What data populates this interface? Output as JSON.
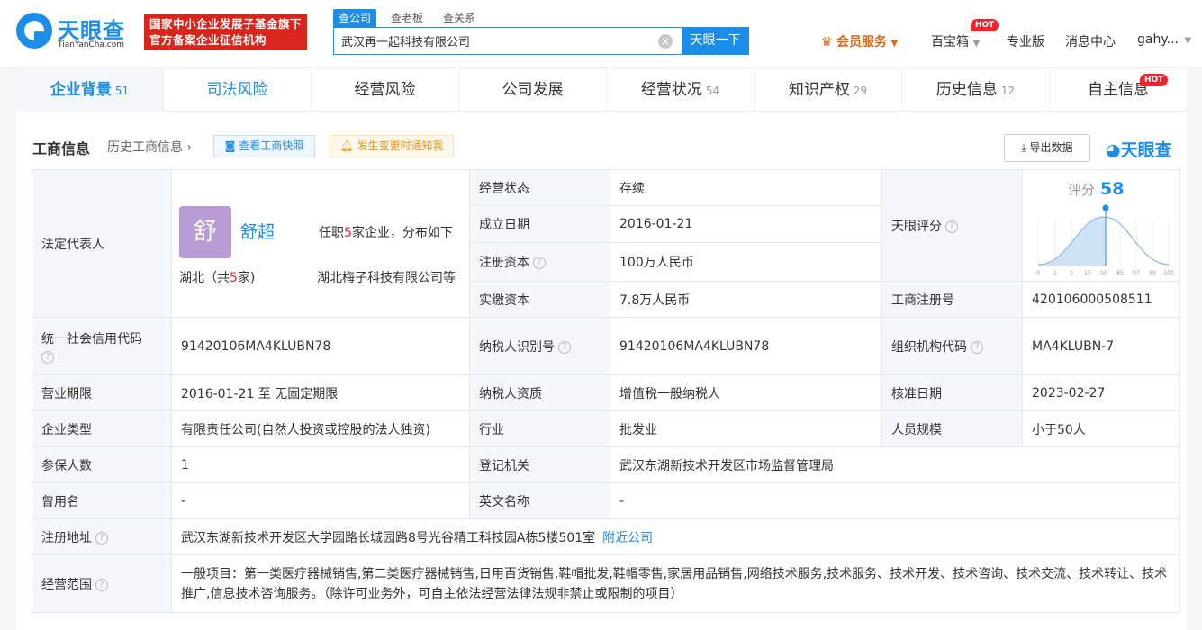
{
  "brand": {
    "name": "天眼查",
    "domain": "TianYanCha.com",
    "badge_line1": "国家中小企业发展子基金旗下",
    "badge_line2": "官方备案企业征信机构"
  },
  "search": {
    "tabs": [
      "查公司",
      "查老板",
      "查关系"
    ],
    "value": "武汉再一起科技有限公司",
    "button": "天眼一下",
    "clear": "×"
  },
  "nav": {
    "vip": "会员服务",
    "baibao": "百宝箱",
    "hot": "HOT",
    "pro": "专业版",
    "msg": "消息中心",
    "user": "gahy..."
  },
  "tabs": [
    {
      "label": "企业背景",
      "count": "51"
    },
    {
      "label": "司法风险",
      "count": ""
    },
    {
      "label": "经营风险",
      "count": ""
    },
    {
      "label": "公司发展",
      "count": ""
    },
    {
      "label": "经营状况",
      "count": "54"
    },
    {
      "label": "知识产权",
      "count": "29"
    },
    {
      "label": "历史信息",
      "count": "12"
    },
    {
      "label": "自主信息",
      "count": ""
    }
  ],
  "section": {
    "title": "工商信息",
    "history": "历史工商信息 ›",
    "snapshot": "查看工商快照",
    "notify": "发生变更时通知我",
    "export": "导出数据",
    "logo": "天眼查"
  },
  "legal": {
    "label": "法定代表人",
    "avatar": "舒",
    "name": "舒超",
    "tenure_pre": "任职",
    "tenure_num": "5",
    "tenure_post": "家企业，分布如下",
    "region_pre": "湖北（共",
    "region_num": "5",
    "region_post": "家)",
    "company": "湖北梅子科技有限公司等"
  },
  "rows": {
    "status_k": "经营状态",
    "status_v": "存续",
    "date_k": "成立日期",
    "date_v": "2016-01-21",
    "capital_k": "注册资本",
    "capital_v": "100万人民币",
    "paid_k": "实缴资本",
    "paid_v": "7.8万人民币",
    "score_k": "天眼评分",
    "score_label": "评分",
    "score_v": "58",
    "regno_k": "工商注册号",
    "regno_v": "420106000508511",
    "credit_k": "统一社会信用代码",
    "credit_v": "91420106MA4KLUBN78",
    "taxid_k": "纳税人识别号",
    "taxid_v": "91420106MA4KLUBN78",
    "org_k": "组织机构代码",
    "org_v": "MA4KLUBN-7",
    "term_k": "营业期限",
    "term_v": "2016-01-21 至 无固定期限",
    "taxq_k": "纳税人资质",
    "taxq_v": "增值税一般纳税人",
    "approve_k": "核准日期",
    "approve_v": "2023-02-27",
    "type_k": "企业类型",
    "type_v": "有限责任公司(自然人投资或控股的法人独资)",
    "industry_k": "行业",
    "industry_v": "批发业",
    "staff_k": "人员规模",
    "staff_v": "小于50人",
    "insured_k": "参保人数",
    "insured_v": "1",
    "authority_k": "登记机关",
    "authority_v": "武汉东湖新技术开发区市场监督管理局",
    "former_k": "曾用名",
    "former_v": "-",
    "en_k": "英文名称",
    "en_v": "-",
    "addr_k": "注册地址",
    "addr_v": "武汉东湖新技术开发区大学园路长城园路8号光谷精工科技园A栋5楼501室",
    "addr_link": "附近公司",
    "scope_k": "经营范围",
    "scope_v": "一般项目：第一类医疗器械销售,第二类医疗器械销售,日用百货销售,鞋帽批发,鞋帽零售,家居用品销售,网络技术服务,技术服务、技术开发、技术咨询、技术交流、技术转让、技术推广,信息技术咨询服务。（除许可业务外，可自主依法经营法律法规非禁止或限制的项目）"
  },
  "score_axis": [
    "0",
    "1",
    "3",
    "15",
    "50",
    "85",
    "97",
    "99",
    "100"
  ],
  "q": "?"
}
